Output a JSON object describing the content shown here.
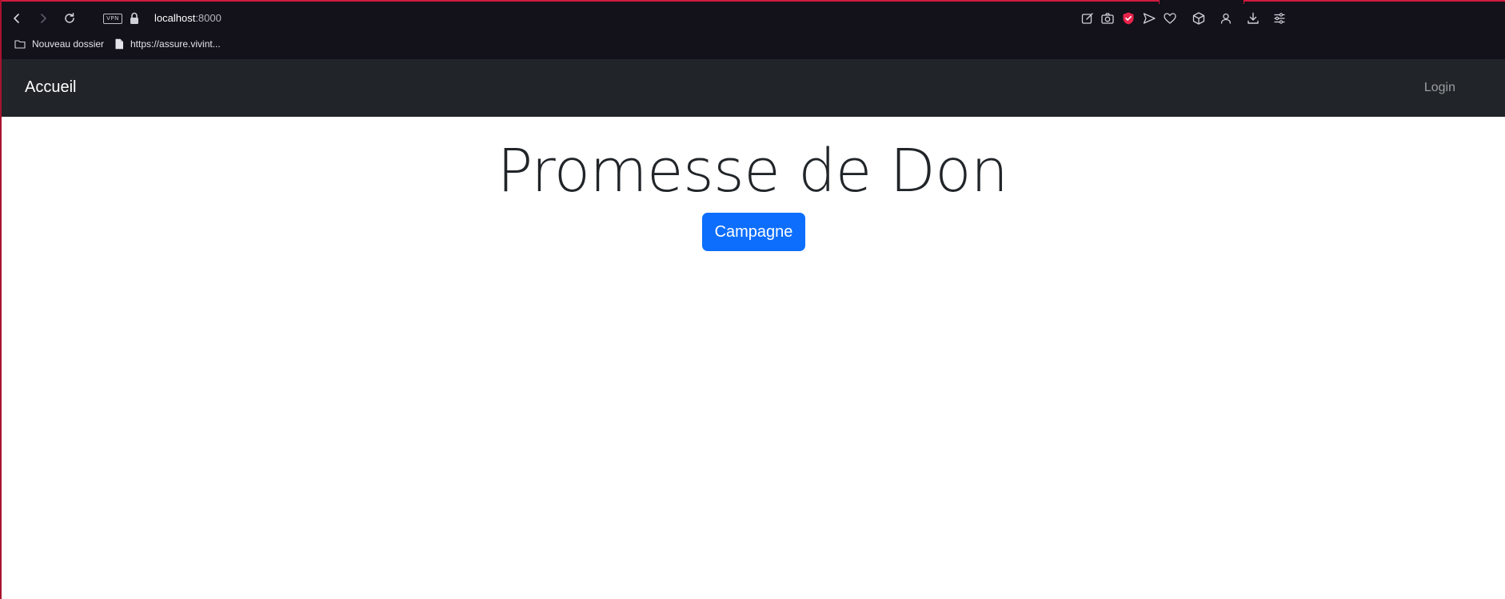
{
  "browser": {
    "vpn_label": "VPN",
    "url_host": "localhost",
    "url_port": ":8000",
    "icons": [
      "back-icon",
      "forward-icon",
      "reload-icon",
      "lock-icon",
      "edit-page-icon",
      "camera-icon",
      "shield-icon",
      "send-icon",
      "heart-icon",
      "cube-icon",
      "user-icon",
      "download-icon",
      "menu-icon"
    ],
    "accent_color": "#d11a40",
    "shield_color": "#e8234a"
  },
  "bookmarks": [
    {
      "label": "Nouveau dossier",
      "icon": "folder-icon"
    },
    {
      "label": "https://assure.vivint...",
      "icon": "document-icon"
    }
  ],
  "navbar": {
    "brand": "Accueil",
    "login": "Login",
    "background": "#212529"
  },
  "main": {
    "title": "Promesse de Don",
    "campaign_button": "Campagne",
    "button_color": "#0d6efd"
  }
}
